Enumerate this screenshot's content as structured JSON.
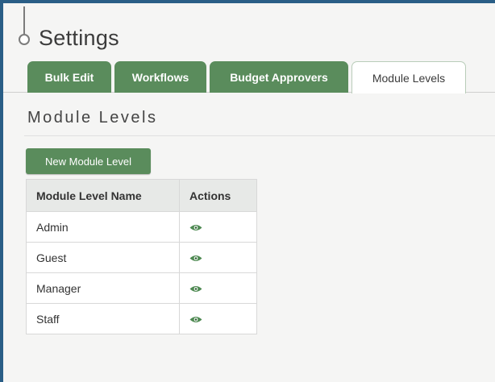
{
  "page": {
    "title": "Settings"
  },
  "tabs": [
    {
      "label": "Bulk Edit",
      "active": false
    },
    {
      "label": "Workflows",
      "active": false
    },
    {
      "label": "Budget Approvers",
      "active": false
    },
    {
      "label": "Module Levels",
      "active": true
    }
  ],
  "section": {
    "title": "Module Levels",
    "new_button_label": "New Module Level"
  },
  "table": {
    "columns": [
      "Module Level Name",
      "Actions"
    ],
    "rows": [
      {
        "name": "Admin",
        "action_icon": "eye-icon"
      },
      {
        "name": "Guest",
        "action_icon": "eye-icon"
      },
      {
        "name": "Manager",
        "action_icon": "eye-icon"
      },
      {
        "name": "Staff",
        "action_icon": "eye-icon"
      }
    ]
  },
  "colors": {
    "accent_green": "#5a8c5c",
    "frame_blue": "#2a5e86"
  }
}
